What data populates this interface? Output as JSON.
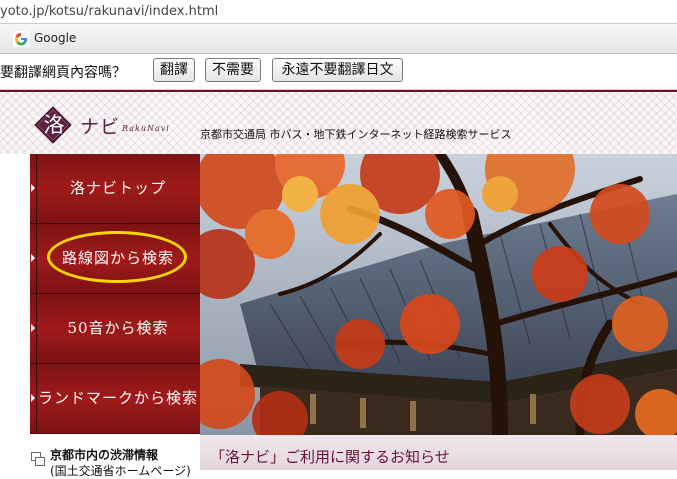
{
  "browser": {
    "url": "yoto.jp/kotsu/rakunavi/index.html"
  },
  "google_toolbar": {
    "label": "Google",
    "icon": "google-g-icon"
  },
  "translate_bar": {
    "message": "要翻譯網頁內容嗎？",
    "translate_button": "翻譯",
    "no_button": "不需要",
    "never_button": "永遠不要翻譯日文"
  },
  "site": {
    "logo_kanji": "洛",
    "logo_kana": "ナビ",
    "logo_roman": "RakuNavi",
    "tagline": "京都市交通局 市バス・地下鉄インターネット経路検索サービス",
    "accent_color": "#7a0e22",
    "nav_color": "#a01a1a",
    "highlight_color": "#ffd700"
  },
  "nav": {
    "items": [
      {
        "label": "洛ナビトップ"
      },
      {
        "label": "路線図から検索"
      },
      {
        "label": "50音から検索"
      },
      {
        "label": "ランドマークから検索"
      }
    ]
  },
  "traffic": {
    "title": "京都市内の渋滞情報",
    "subtitle": "(国土交通省ホームページ)"
  },
  "notice": {
    "title": "「洛ナビ」ご利用に関するお知らせ"
  }
}
